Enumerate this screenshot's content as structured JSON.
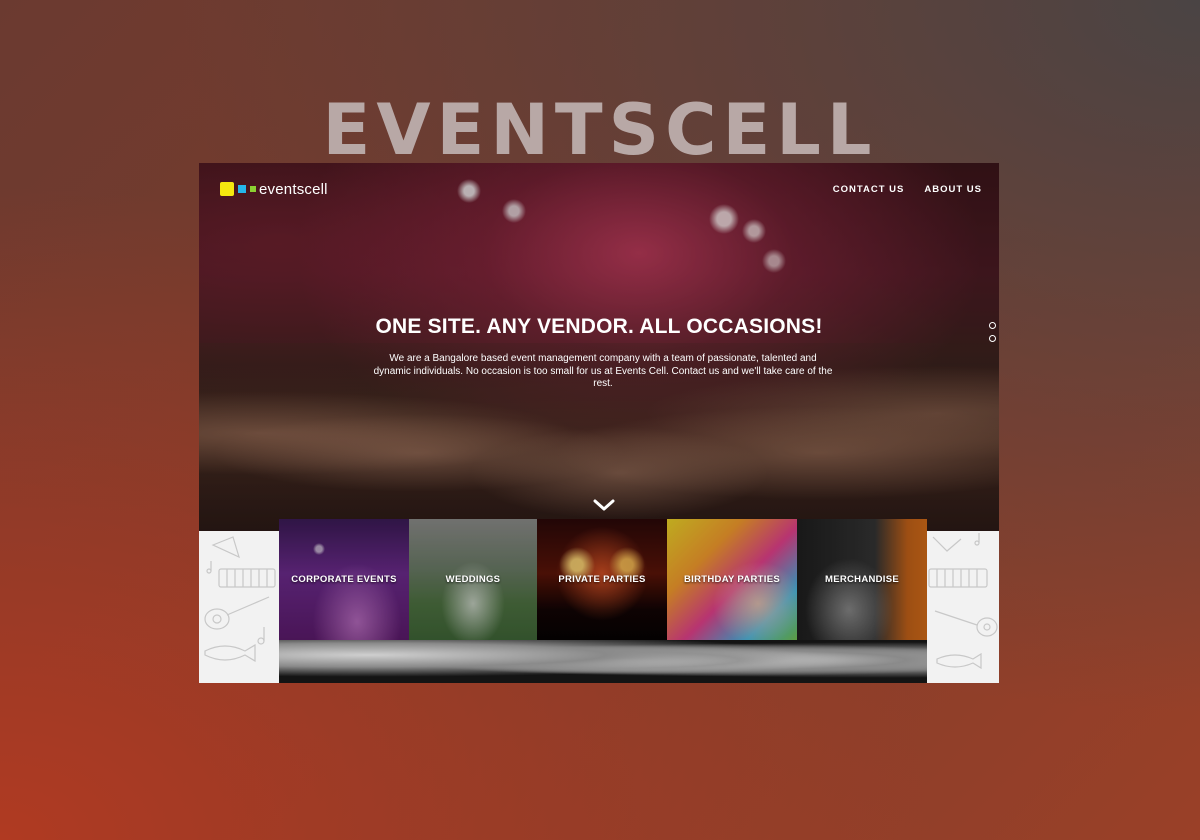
{
  "brand_title": "EVENTSCELL",
  "site": {
    "logo": {
      "text": "eventscell",
      "colors": [
        "#f4e80f",
        "#25b6ea",
        "#8cd132"
      ]
    },
    "nav": [
      {
        "label": "CONTACT US"
      },
      {
        "label": "ABOUT US"
      }
    ],
    "hero": {
      "title": "ONE SITE. ANY VENDOR. ALL OCCASIONS!",
      "subtitle": "We are a Bangalore based event management company with a team of passionate, talented and dynamic individuals. No occasion is too small for us at Events Cell. Contact us and we'll take care of the rest.",
      "slides": 2
    },
    "categories": [
      {
        "label": "CORPORATE EVENTS"
      },
      {
        "label": "WEDDINGS"
      },
      {
        "label": "PRIVATE PARTIES"
      },
      {
        "label": "BIRTHDAY PARTIES"
      },
      {
        "label": "MERCHANDISE"
      }
    ]
  }
}
